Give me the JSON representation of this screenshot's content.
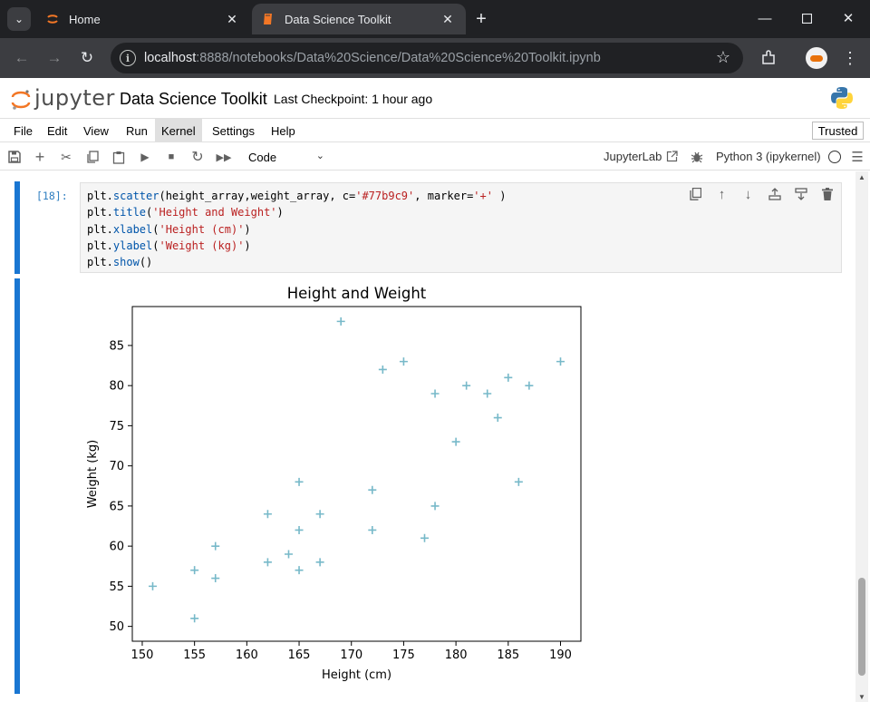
{
  "browser": {
    "tabs": [
      {
        "title": "Home",
        "active": false
      },
      {
        "title": "Data Science Toolkit",
        "active": true
      }
    ],
    "url_host": "localhost",
    "url_rest": ":8888/notebooks/Data%20Science/Data%20Science%20Toolkit.ipynb"
  },
  "jupyter": {
    "logo_text": "jupyter",
    "notebook_title": "Data Science Toolkit",
    "checkpoint": "Last Checkpoint: 1 hour ago",
    "menu": [
      "File",
      "Edit",
      "View",
      "Run",
      "Kernel",
      "Settings",
      "Help"
    ],
    "active_menu": "Kernel",
    "trusted": "Trusted",
    "cell_type": "Code",
    "jupyterlab_label": "JupyterLab",
    "kernel_name": "Python 3 (ipykernel)"
  },
  "cell": {
    "prompt": "[18]:",
    "code_lines": [
      "plt.scatter(height_array,weight_array, c='#77b9c9', marker='+' )",
      "plt.title('Height and Weight')",
      "plt.xlabel('Height (cm)')",
      "plt.ylabel('Weight (kg)')",
      "plt.show()"
    ]
  },
  "colors": {
    "accent": "#1976d2",
    "marker": "#77b9c9",
    "tabbar": "#202124",
    "addressbar": "#3c3d41",
    "jupyter_orange": "#f37726"
  },
  "icons": [
    "chevron-down-icon",
    "jupyter-tab-icon",
    "notebook-tab-icon",
    "close-icon",
    "plus-icon",
    "minimize-icon",
    "maximize-icon",
    "back-icon",
    "forward-icon",
    "reload-icon",
    "site-info-icon",
    "star-icon",
    "extensions-icon",
    "save-icon",
    "cut-icon",
    "copy-icon",
    "paste-icon",
    "run-icon",
    "stop-icon",
    "restart-icon",
    "fast-forward-icon",
    "external-link-icon",
    "debugger-icon",
    "kernel-status-icon",
    "duplicate-icon",
    "move-up-icon",
    "move-down-icon",
    "insert-above-icon",
    "insert-below-icon",
    "delete-icon",
    "python-logo-icon"
  ],
  "chart_data": {
    "type": "scatter",
    "title": "Height and Weight",
    "xlabel": "Height (cm)",
    "ylabel": "Weight (kg)",
    "xlim": [
      149.05,
      191.95
    ],
    "ylim": [
      48.15,
      89.85
    ],
    "xticks": [
      150,
      155,
      160,
      165,
      170,
      175,
      180,
      185,
      190
    ],
    "yticks": [
      50,
      55,
      60,
      65,
      70,
      75,
      80,
      85
    ],
    "marker": "+",
    "color": "#77b9c9",
    "grid": false,
    "points": [
      {
        "x": 151,
        "y": 55
      },
      {
        "x": 155,
        "y": 51
      },
      {
        "x": 155,
        "y": 57
      },
      {
        "x": 157,
        "y": 56
      },
      {
        "x": 157,
        "y": 60
      },
      {
        "x": 162,
        "y": 58
      },
      {
        "x": 162,
        "y": 64
      },
      {
        "x": 164,
        "y": 59
      },
      {
        "x": 165,
        "y": 57
      },
      {
        "x": 165,
        "y": 62
      },
      {
        "x": 165,
        "y": 68
      },
      {
        "x": 167,
        "y": 58
      },
      {
        "x": 167,
        "y": 64
      },
      {
        "x": 169,
        "y": 88
      },
      {
        "x": 172,
        "y": 62
      },
      {
        "x": 172,
        "y": 67
      },
      {
        "x": 173,
        "y": 82
      },
      {
        "x": 175,
        "y": 83
      },
      {
        "x": 177,
        "y": 61
      },
      {
        "x": 178,
        "y": 65
      },
      {
        "x": 178,
        "y": 79
      },
      {
        "x": 180,
        "y": 73
      },
      {
        "x": 181,
        "y": 80
      },
      {
        "x": 183,
        "y": 79
      },
      {
        "x": 184,
        "y": 76
      },
      {
        "x": 185,
        "y": 81
      },
      {
        "x": 186,
        "y": 68
      },
      {
        "x": 187,
        "y": 80
      },
      {
        "x": 190,
        "y": 83
      }
    ]
  }
}
